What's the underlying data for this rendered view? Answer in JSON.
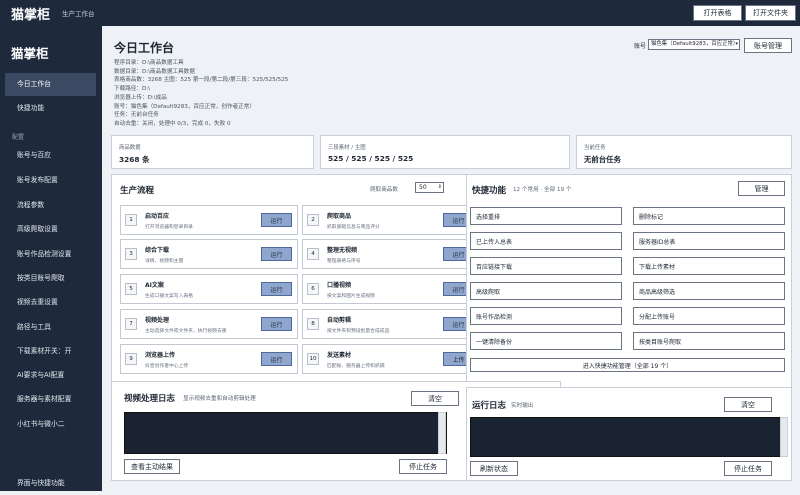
{
  "topbar": {
    "logo": "猫掌柜",
    "subtitle": "生产工作台",
    "open_table": "打开表格",
    "open_folder": "打开文件夹"
  },
  "sidebar": {
    "brand": "猫掌柜",
    "items_top": [
      "今日工作台",
      "快捷功能"
    ],
    "group_label": "配置",
    "items": [
      "账号与百应",
      "账号发布配置",
      "流程参数",
      "高级爬取设置",
      "账号作品检测设置",
      "按类目账号爬取",
      "视频去重设置",
      "路径与工具",
      "下载素材开关：开",
      "AI要求与AI配置",
      "服务器与素材配置",
      "小红书与微小二"
    ],
    "bottom": "界面与快捷功能"
  },
  "header": {
    "title": "今日工作台",
    "info_lines": [
      "程序目录：D:\\商品数据工具",
      "数据目录：D:\\商品数据工具数据",
      "表格商品数：3268    主图：525    第一段/第二段/第三段：525/525/525",
      "下载路径：D:\\",
      "浏览器上传：D:\\成品",
      "账号：猫色集（Default9283，百应正常，创作者正常）",
      "任务：无前台任务",
      "自动去重：关闭，处理中 0/3，完成 0，失败 0"
    ],
    "account_label": "账号",
    "account_value": "猫色集（Default9283，百应正常）",
    "account_manage": "账号管理"
  },
  "stats": [
    {
      "label": "商品数据",
      "value": "3268 条"
    },
    {
      "label": "三段素材 / 主图",
      "value": "525 / 525 / 525 / 525"
    },
    {
      "label": "当前任务",
      "value": "无前台任务"
    }
  ],
  "flow": {
    "title": "生产流程",
    "count_label": "爬取商品数",
    "count_value": "50",
    "steps": [
      {
        "num": "1",
        "title": "启动百应",
        "desc": "打开浏览器和登录目录",
        "btn": "运行"
      },
      {
        "num": "2",
        "title": "爬取商品",
        "desc": "抓取基础信息与商品评分",
        "btn": "运行"
      },
      {
        "num": "3",
        "title": "综合下载",
        "desc": "详情、视频和主图",
        "btn": "运行"
      },
      {
        "num": "4",
        "title": "整理无视频",
        "desc": "整理表格与序号",
        "btn": "运行"
      },
      {
        "num": "5",
        "title": "AI文案",
        "desc": "生成口播文案写入表格",
        "btn": "运行"
      },
      {
        "num": "6",
        "title": "口播视频",
        "desc": "按文案和图片生成视频",
        "btn": "运行"
      },
      {
        "num": "7",
        "title": "视频处理",
        "desc": "主动选择文件或文件夹，执行视频去重",
        "btn": "运行"
      },
      {
        "num": "8",
        "title": "自动剪辑",
        "desc": "按文件夹和预设批量合成成品",
        "btn": "运行"
      },
      {
        "num": "9",
        "title": "浏览器上传",
        "desc": "抖音创作者中心上传",
        "btn": "运行"
      },
      {
        "num": "10",
        "title": "发送素材",
        "desc": "匹配账、服务器上传和抓捕",
        "btn": "上传"
      }
    ]
  },
  "quick": {
    "title": "快捷功能",
    "meta": "12 个常用 · 全部 19 个",
    "manage": "管理",
    "buttons": [
      "选择重排",
      "删除标记",
      "已上传入总表",
      "服务器ID总表",
      "百应链接下载",
      "下载上传素材",
      "高级爬取",
      "商品高级筛选",
      "账号作品检测",
      "分配上传账号",
      "一键清除备份",
      "按类目账号爬取"
    ],
    "more": "进入快捷功能管理（全部 19 个）"
  },
  "videolog": {
    "title": "视频处理日志",
    "subtitle": "显示视频去重和自动剪辑处理",
    "clear": "清空",
    "view": "查看主动结果",
    "stop": "停止任务"
  },
  "runlog": {
    "title": "运行日志",
    "subtitle": "实时输出",
    "clear": "清空",
    "refresh": "刷新状态",
    "stop": "停止任务"
  }
}
